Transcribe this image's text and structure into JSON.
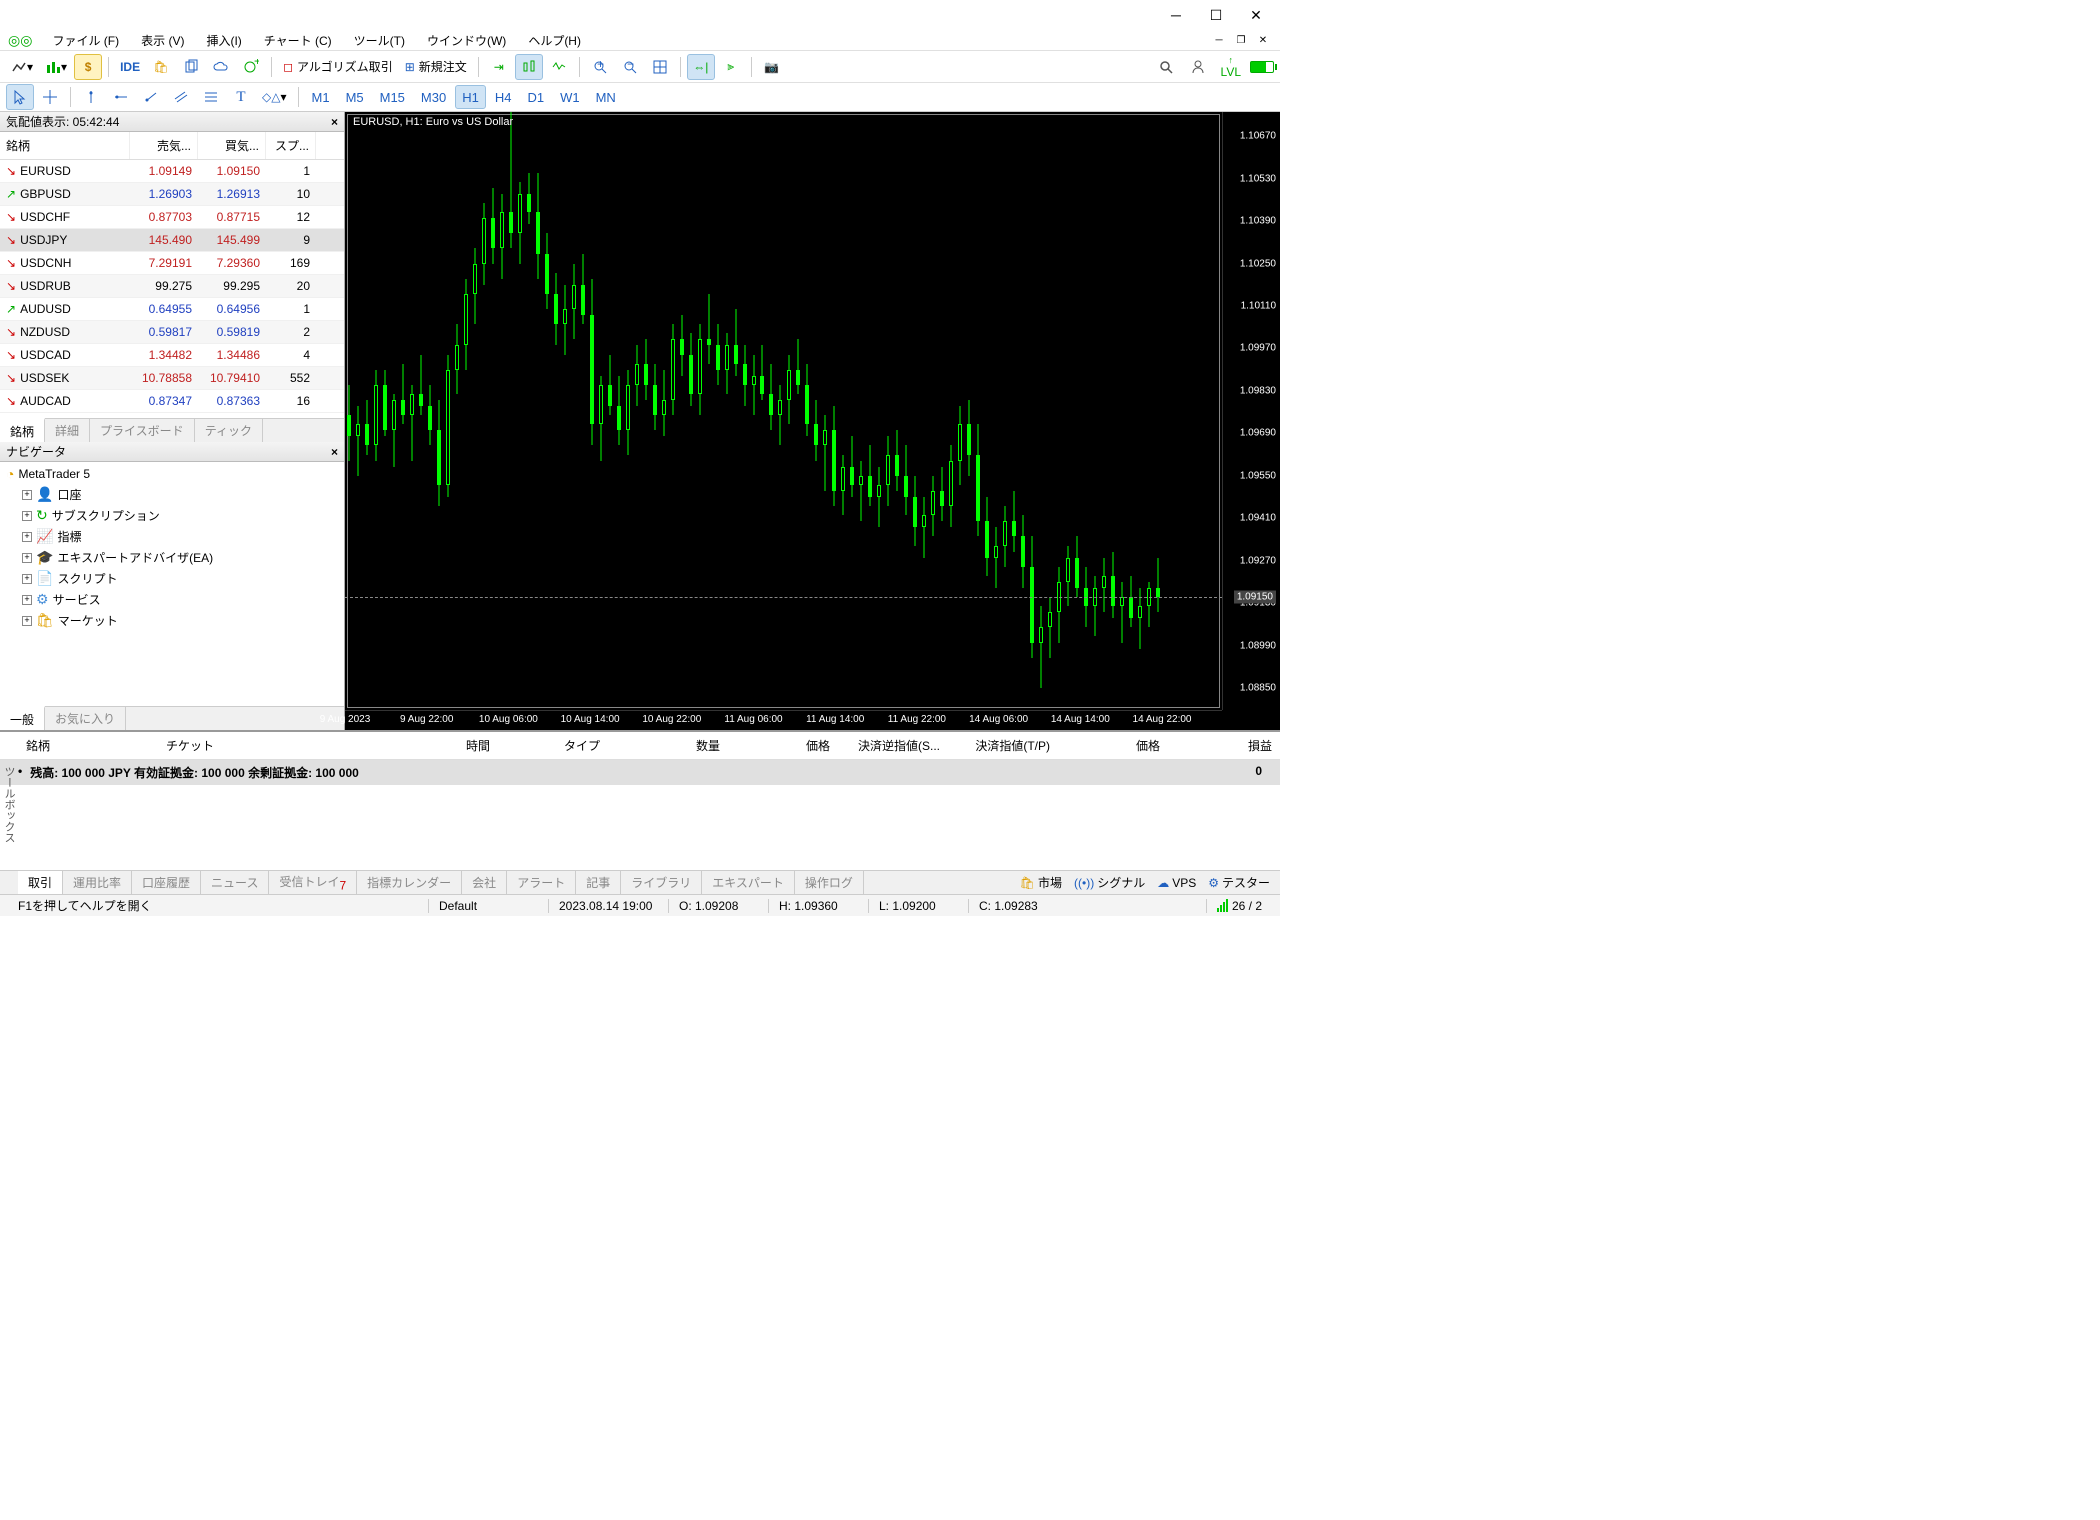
{
  "menu": {
    "file": "ファイル (F)",
    "view": "表示 (V)",
    "insert": "挿入(I)",
    "chart": "チャート (C)",
    "tool": "ツール(T)",
    "window": "ウインドウ(W)",
    "help": "ヘルプ(H)"
  },
  "toolbar": {
    "ide": "IDE",
    "algo": "アルゴリズム取引",
    "neworder": "新規注文",
    "level": "LVL"
  },
  "timeframes": [
    "M1",
    "M5",
    "M15",
    "M30",
    "H1",
    "H4",
    "D1",
    "W1",
    "MN"
  ],
  "timeframe_active": "H1",
  "marketwatch": {
    "title": "気配値表示: 05:42:44",
    "cols": {
      "symbol": "銘柄",
      "bid": "売気...",
      "ask": "買気...",
      "spread": "スプ..."
    },
    "rows": [
      {
        "sym": "EURUSD",
        "dir": "down",
        "bid": "1.09149",
        "ask": "1.09150",
        "sp": "1",
        "style": "red"
      },
      {
        "sym": "GBPUSD",
        "dir": "up",
        "bid": "1.26903",
        "ask": "1.26913",
        "sp": "10",
        "style": "blue"
      },
      {
        "sym": "USDCHF",
        "dir": "down",
        "bid": "0.87703",
        "ask": "0.87715",
        "sp": "12",
        "style": "red"
      },
      {
        "sym": "USDJPY",
        "dir": "down",
        "bid": "145.490",
        "ask": "145.499",
        "sp": "9",
        "style": "red",
        "sel": true
      },
      {
        "sym": "USDCNH",
        "dir": "down",
        "bid": "7.29191",
        "ask": "7.29360",
        "sp": "169",
        "style": "red"
      },
      {
        "sym": "USDRUB",
        "dir": "down",
        "bid": "99.275",
        "ask": "99.295",
        "sp": "20",
        "style": "black"
      },
      {
        "sym": "AUDUSD",
        "dir": "up",
        "bid": "0.64955",
        "ask": "0.64956",
        "sp": "1",
        "style": "blue"
      },
      {
        "sym": "NZDUSD",
        "dir": "down",
        "bid": "0.59817",
        "ask": "0.59819",
        "sp": "2",
        "style": "blue"
      },
      {
        "sym": "USDCAD",
        "dir": "down",
        "bid": "1.34482",
        "ask": "1.34486",
        "sp": "4",
        "style": "red"
      },
      {
        "sym": "USDSEK",
        "dir": "down",
        "bid": "10.78858",
        "ask": "10.79410",
        "sp": "552",
        "style": "red"
      },
      {
        "sym": "AUDCAD",
        "dir": "down",
        "bid": "0.87347",
        "ask": "0.87363",
        "sp": "16",
        "style": "blue"
      }
    ],
    "tabs": [
      "銘柄",
      "詳細",
      "プライスボード",
      "ティック"
    ]
  },
  "navigator": {
    "title": "ナビゲータ",
    "root": "MetaTrader 5",
    "items": [
      {
        "icon": "👤",
        "label": "口座",
        "color": "#4a90d9"
      },
      {
        "icon": "↻",
        "label": "サブスクリプション",
        "color": "#0a0"
      },
      {
        "icon": "📈",
        "label": "指標",
        "color": "#888"
      },
      {
        "icon": "🎓",
        "label": "エキスパートアドバイザ(EA)",
        "color": "#2060c0"
      },
      {
        "icon": "📄",
        "label": "スクリプト",
        "color": "#e0a000"
      },
      {
        "icon": "⚙",
        "label": "サービス",
        "color": "#4a90d9"
      },
      {
        "icon": "🛍",
        "label": "マーケット",
        "color": "#e0a000"
      }
    ],
    "tabs": [
      "一般",
      "お気に入り"
    ]
  },
  "chart": {
    "title": "EURUSD, H1:  Euro vs US Dollar"
  },
  "chart_data": {
    "type": "candlestick",
    "symbol": "EURUSD",
    "timeframe": "H1",
    "ylim": [
      1.0885,
      1.1075
    ],
    "yticks": [
      1.1067,
      1.1053,
      1.1039,
      1.1025,
      1.1011,
      1.0997,
      1.0983,
      1.0969,
      1.0955,
      1.0941,
      1.0927,
      1.0913,
      1.0899,
      1.0885
    ],
    "current_price": 1.0915,
    "xlabels": [
      "9 Aug 2023",
      "9 Aug 22:00",
      "10 Aug 06:00",
      "10 Aug 14:00",
      "10 Aug 22:00",
      "11 Aug 06:00",
      "11 Aug 14:00",
      "11 Aug 22:00",
      "14 Aug 06:00",
      "14 Aug 14:00",
      "14 Aug 22:00"
    ],
    "candles": [
      {
        "o": 1.0975,
        "h": 1.0985,
        "l": 1.096,
        "c": 1.0968
      },
      {
        "o": 1.0968,
        "h": 1.0978,
        "l": 1.0955,
        "c": 1.0972
      },
      {
        "o": 1.0972,
        "h": 1.098,
        "l": 1.0962,
        "c": 1.0965
      },
      {
        "o": 1.0965,
        "h": 1.099,
        "l": 1.096,
        "c": 1.0985
      },
      {
        "o": 1.0985,
        "h": 1.099,
        "l": 1.0968,
        "c": 1.097
      },
      {
        "o": 1.097,
        "h": 1.0982,
        "l": 1.0958,
        "c": 1.098
      },
      {
        "o": 1.098,
        "h": 1.0992,
        "l": 1.0972,
        "c": 1.0975
      },
      {
        "o": 1.0975,
        "h": 1.0985,
        "l": 1.096,
        "c": 1.0982
      },
      {
        "o": 1.0982,
        "h": 1.0995,
        "l": 1.0975,
        "c": 1.0978
      },
      {
        "o": 1.0978,
        "h": 1.0985,
        "l": 1.0965,
        "c": 1.097
      },
      {
        "o": 1.097,
        "h": 1.098,
        "l": 1.0945,
        "c": 1.0952
      },
      {
        "o": 1.0952,
        "h": 1.0995,
        "l": 1.0948,
        "c": 1.099
      },
      {
        "o": 1.099,
        "h": 1.1005,
        "l": 1.0982,
        "c": 1.0998
      },
      {
        "o": 1.0998,
        "h": 1.102,
        "l": 1.099,
        "c": 1.1015
      },
      {
        "o": 1.1015,
        "h": 1.103,
        "l": 1.1005,
        "c": 1.1025
      },
      {
        "o": 1.1025,
        "h": 1.1045,
        "l": 1.1018,
        "c": 1.104
      },
      {
        "o": 1.104,
        "h": 1.105,
        "l": 1.1025,
        "c": 1.103
      },
      {
        "o": 1.103,
        "h": 1.1048,
        "l": 1.102,
        "c": 1.1042
      },
      {
        "o": 1.1042,
        "h": 1.1075,
        "l": 1.103,
        "c": 1.1035
      },
      {
        "o": 1.1035,
        "h": 1.1052,
        "l": 1.1025,
        "c": 1.1048
      },
      {
        "o": 1.1048,
        "h": 1.1055,
        "l": 1.1038,
        "c": 1.1042
      },
      {
        "o": 1.1042,
        "h": 1.1055,
        "l": 1.102,
        "c": 1.1028
      },
      {
        "o": 1.1028,
        "h": 1.1035,
        "l": 1.101,
        "c": 1.1015
      },
      {
        "o": 1.1015,
        "h": 1.1022,
        "l": 1.0998,
        "c": 1.1005
      },
      {
        "o": 1.1005,
        "h": 1.1018,
        "l": 1.0995,
        "c": 1.101
      },
      {
        "o": 1.101,
        "h": 1.1025,
        "l": 1.1,
        "c": 1.1018
      },
      {
        "o": 1.1018,
        "h": 1.1028,
        "l": 1.1005,
        "c": 1.1008
      },
      {
        "o": 1.1008,
        "h": 1.102,
        "l": 1.0965,
        "c": 1.0972
      },
      {
        "o": 1.0972,
        "h": 1.0988,
        "l": 1.096,
        "c": 1.0985
      },
      {
        "o": 1.0985,
        "h": 1.0995,
        "l": 1.0975,
        "c": 1.0978
      },
      {
        "o": 1.0978,
        "h": 1.0988,
        "l": 1.0965,
        "c": 1.097
      },
      {
        "o": 1.097,
        "h": 1.099,
        "l": 1.0962,
        "c": 1.0985
      },
      {
        "o": 1.0985,
        "h": 1.0998,
        "l": 1.0978,
        "c": 1.0992
      },
      {
        "o": 1.0992,
        "h": 1.1,
        "l": 1.098,
        "c": 1.0985
      },
      {
        "o": 1.0985,
        "h": 1.0992,
        "l": 1.097,
        "c": 1.0975
      },
      {
        "o": 1.0975,
        "h": 1.099,
        "l": 1.0968,
        "c": 1.098
      },
      {
        "o": 1.098,
        "h": 1.1005,
        "l": 1.0975,
        "c": 1.1
      },
      {
        "o": 1.1,
        "h": 1.1008,
        "l": 1.0988,
        "c": 1.0995
      },
      {
        "o": 1.0995,
        "h": 1.1002,
        "l": 1.0978,
        "c": 1.0982
      },
      {
        "o": 1.0982,
        "h": 1.1005,
        "l": 1.0975,
        "c": 1.1
      },
      {
        "o": 1.1,
        "h": 1.1015,
        "l": 1.0992,
        "c": 1.0998
      },
      {
        "o": 1.0998,
        "h": 1.1005,
        "l": 1.0985,
        "c": 1.099
      },
      {
        "o": 1.099,
        "h": 1.1002,
        "l": 1.0982,
        "c": 1.0998
      },
      {
        "o": 1.0998,
        "h": 1.101,
        "l": 1.0988,
        "c": 1.0992
      },
      {
        "o": 1.0992,
        "h": 1.0998,
        "l": 1.0978,
        "c": 1.0985
      },
      {
        "o": 1.0985,
        "h": 1.0995,
        "l": 1.0975,
        "c": 1.0988
      },
      {
        "o": 1.0988,
        "h": 1.0998,
        "l": 1.098,
        "c": 1.0982
      },
      {
        "o": 1.0982,
        "h": 1.0992,
        "l": 1.097,
        "c": 1.0975
      },
      {
        "o": 1.0975,
        "h": 1.0985,
        "l": 1.0965,
        "c": 1.098
      },
      {
        "o": 1.098,
        "h": 1.0995,
        "l": 1.0972,
        "c": 1.099
      },
      {
        "o": 1.099,
        "h": 1.1,
        "l": 1.0982,
        "c": 1.0985
      },
      {
        "o": 1.0985,
        "h": 1.0992,
        "l": 1.0968,
        "c": 1.0972
      },
      {
        "o": 1.0972,
        "h": 1.098,
        "l": 1.096,
        "c": 1.0965
      },
      {
        "o": 1.0965,
        "h": 1.0975,
        "l": 1.095,
        "c": 1.097
      },
      {
        "o": 1.097,
        "h": 1.0978,
        "l": 1.0945,
        "c": 1.095
      },
      {
        "o": 1.095,
        "h": 1.0962,
        "l": 1.0942,
        "c": 1.0958
      },
      {
        "o": 1.0958,
        "h": 1.0968,
        "l": 1.0948,
        "c": 1.0952
      },
      {
        "o": 1.0952,
        "h": 1.096,
        "l": 1.094,
        "c": 1.0955
      },
      {
        "o": 1.0955,
        "h": 1.0965,
        "l": 1.0945,
        "c": 1.0948
      },
      {
        "o": 1.0948,
        "h": 1.0958,
        "l": 1.0938,
        "c": 1.0952
      },
      {
        "o": 1.0952,
        "h": 1.0968,
        "l": 1.0945,
        "c": 1.0962
      },
      {
        "o": 1.0962,
        "h": 1.097,
        "l": 1.095,
        "c": 1.0955
      },
      {
        "o": 1.0955,
        "h": 1.0965,
        "l": 1.0942,
        "c": 1.0948
      },
      {
        "o": 1.0948,
        "h": 1.0955,
        "l": 1.0932,
        "c": 1.0938
      },
      {
        "o": 1.0938,
        "h": 1.0948,
        "l": 1.0928,
        "c": 1.0942
      },
      {
        "o": 1.0942,
        "h": 1.0955,
        "l": 1.0935,
        "c": 1.095
      },
      {
        "o": 1.095,
        "h": 1.0958,
        "l": 1.094,
        "c": 1.0945
      },
      {
        "o": 1.0945,
        "h": 1.0965,
        "l": 1.0938,
        "c": 1.096
      },
      {
        "o": 1.096,
        "h": 1.0978,
        "l": 1.0952,
        "c": 1.0972
      },
      {
        "o": 1.0972,
        "h": 1.098,
        "l": 1.0955,
        "c": 1.0962
      },
      {
        "o": 1.0962,
        "h": 1.0972,
        "l": 1.0935,
        "c": 1.094
      },
      {
        "o": 1.094,
        "h": 1.0948,
        "l": 1.0922,
        "c": 1.0928
      },
      {
        "o": 1.0928,
        "h": 1.0938,
        "l": 1.0918,
        "c": 1.0932
      },
      {
        "o": 1.0932,
        "h": 1.0945,
        "l": 1.0925,
        "c": 1.094
      },
      {
        "o": 1.094,
        "h": 1.095,
        "l": 1.093,
        "c": 1.0935
      },
      {
        "o": 1.0935,
        "h": 1.0942,
        "l": 1.0918,
        "c": 1.0925
      },
      {
        "o": 1.0925,
        "h": 1.0935,
        "l": 1.0895,
        "c": 1.09
      },
      {
        "o": 1.09,
        "h": 1.0912,
        "l": 1.0885,
        "c": 1.0905
      },
      {
        "o": 1.0905,
        "h": 1.0915,
        "l": 1.0895,
        "c": 1.091
      },
      {
        "o": 1.091,
        "h": 1.0925,
        "l": 1.09,
        "c": 1.092
      },
      {
        "o": 1.092,
        "h": 1.0932,
        "l": 1.0912,
        "c": 1.0928
      },
      {
        "o": 1.0928,
        "h": 1.0935,
        "l": 1.0915,
        "c": 1.0918
      },
      {
        "o": 1.0918,
        "h": 1.0925,
        "l": 1.0905,
        "c": 1.0912
      },
      {
        "o": 1.0912,
        "h": 1.0922,
        "l": 1.0902,
        "c": 1.0918
      },
      {
        "o": 1.0918,
        "h": 1.0928,
        "l": 1.091,
        "c": 1.0922
      },
      {
        "o": 1.0922,
        "h": 1.093,
        "l": 1.0908,
        "c": 1.0912
      },
      {
        "o": 1.0912,
        "h": 1.092,
        "l": 1.09,
        "c": 1.0915
      },
      {
        "o": 1.0915,
        "h": 1.0922,
        "l": 1.0905,
        "c": 1.0908
      },
      {
        "o": 1.0908,
        "h": 1.0918,
        "l": 1.0898,
        "c": 1.0912
      },
      {
        "o": 1.0912,
        "h": 1.092,
        "l": 1.0905,
        "c": 1.0918
      },
      {
        "o": 1.0918,
        "h": 1.0928,
        "l": 1.091,
        "c": 1.0915
      }
    ]
  },
  "toolbox": {
    "vlabel": "ツールボックス",
    "cols": {
      "symbol": "銘柄",
      "ticket": "チケット",
      "time": "時間",
      "type": "タイプ",
      "volume": "数量",
      "price": "価格",
      "sl": "決済逆指値(S...",
      "tp": "決済指値(T/P)",
      "price2": "価格",
      "profit": "損益"
    },
    "balance": "残高: 100 000 JPY  有効証拠金: 100 000  余剰証拠金: 100 000",
    "balance_amount": "0",
    "tabs": [
      "取引",
      "運用比率",
      "口座履歴",
      "ニュース",
      "受信トレイ",
      "指標カレンダー",
      "会社",
      "アラート",
      "記事",
      "ライブラリ",
      "エキスパート",
      "操作ログ"
    ],
    "right": {
      "market": "市場",
      "signals": "シグナル",
      "vps": "VPS",
      "tester": "テスター"
    }
  },
  "statusbar": {
    "help": "F1を押してヘルプを開く",
    "profile": "Default",
    "date": "2023.08.14 19:00",
    "o": "O: 1.09208",
    "h": "H: 1.09360",
    "l": "L: 1.09200",
    "c": "C: 1.09283",
    "conn": "26 / 2"
  }
}
